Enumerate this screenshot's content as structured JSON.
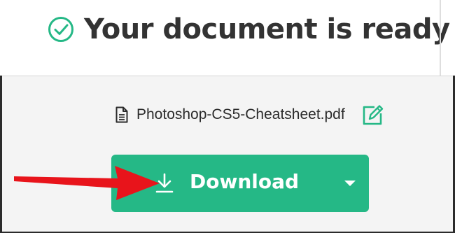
{
  "header": {
    "title": "Your document is ready",
    "icon": "check-circle-icon",
    "accent_color": "#25b886"
  },
  "file": {
    "name": "Photoshop-CS5-Cheatsheet.pdf",
    "file_icon": "document-icon",
    "edit_icon": "edit-icon"
  },
  "download": {
    "label": "Download",
    "icon": "download-icon",
    "dropdown_icon": "caret-down-icon",
    "color": "#25b886"
  },
  "annotation": {
    "arrow_icon": "red-arrow-icon",
    "color": "#e8141b"
  }
}
